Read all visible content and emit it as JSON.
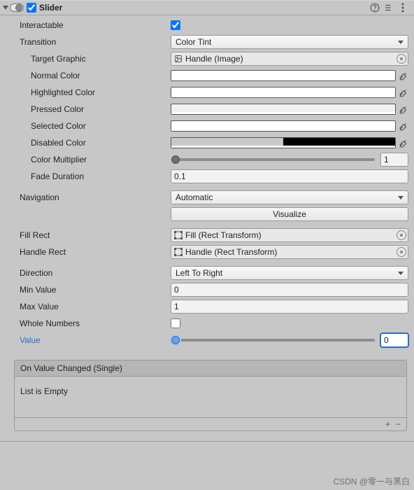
{
  "header": {
    "title": "Slider",
    "enabled": true
  },
  "fields": {
    "interactable": {
      "label": "Interactable",
      "checked": true
    },
    "transition": {
      "label": "Transition",
      "value": "Color Tint"
    },
    "targetGraphic": {
      "label": "Target Graphic",
      "value": "Handle (Image)"
    },
    "normalColor": {
      "label": "Normal Color"
    },
    "highlightedColor": {
      "label": "Highlighted Color"
    },
    "pressedColor": {
      "label": "Pressed Color"
    },
    "selectedColor": {
      "label": "Selected Color"
    },
    "disabledColor": {
      "label": "Disabled Color"
    },
    "colorMultiplier": {
      "label": "Color Multiplier",
      "value": "1",
      "sliderPercent": 0
    },
    "fadeDuration": {
      "label": "Fade Duration",
      "value": "0.1"
    },
    "navigation": {
      "label": "Navigation",
      "value": "Automatic"
    },
    "visualizeButton": "Visualize",
    "fillRect": {
      "label": "Fill Rect",
      "value": "Fill (Rect Transform)"
    },
    "handleRect": {
      "label": "Handle Rect",
      "value": "Handle (Rect Transform)"
    },
    "direction": {
      "label": "Direction",
      "value": "Left To Right"
    },
    "minValue": {
      "label": "Min Value",
      "value": "0"
    },
    "maxValue": {
      "label": "Max Value",
      "value": "1"
    },
    "wholeNumbers": {
      "label": "Whole Numbers",
      "checked": false
    },
    "value": {
      "label": "Value",
      "value": "0",
      "sliderPercent": 0
    }
  },
  "event": {
    "title": "On Value Changed (Single)",
    "empty": "List is Empty",
    "plus": "+",
    "minus": "−"
  },
  "watermark": "CSDN @零一与黑白"
}
